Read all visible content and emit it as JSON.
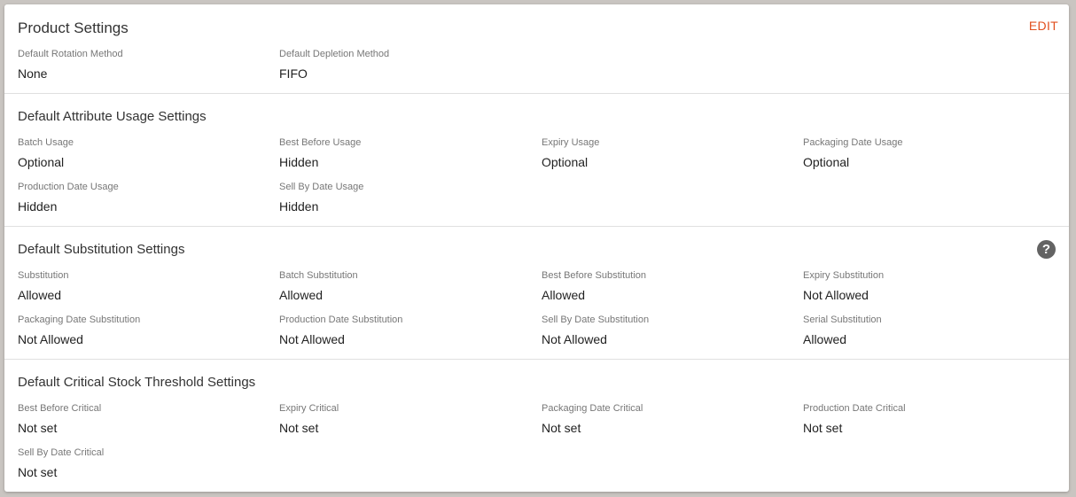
{
  "product_settings": {
    "title": "Product Settings",
    "edit_label": "EDIT",
    "fields": [
      {
        "label": "Default Rotation Method",
        "value": "None"
      },
      {
        "label": "Default Depletion Method",
        "value": "FIFO"
      }
    ]
  },
  "attribute_usage": {
    "title": "Default Attribute Usage Settings",
    "fields": [
      {
        "label": "Batch Usage",
        "value": "Optional"
      },
      {
        "label": "Best Before Usage",
        "value": "Hidden"
      },
      {
        "label": "Expiry Usage",
        "value": "Optional"
      },
      {
        "label": "Packaging Date Usage",
        "value": "Optional"
      },
      {
        "label": "Production Date Usage",
        "value": "Hidden"
      },
      {
        "label": "Sell By Date Usage",
        "value": "Hidden"
      }
    ]
  },
  "substitution": {
    "title": "Default Substitution Settings",
    "help_icon": "?",
    "fields": [
      {
        "label": "Substitution",
        "value": "Allowed"
      },
      {
        "label": "Batch Substitution",
        "value": "Allowed"
      },
      {
        "label": "Best Before Substitution",
        "value": "Allowed"
      },
      {
        "label": "Expiry Substitution",
        "value": "Not Allowed"
      },
      {
        "label": "Packaging Date Substitution",
        "value": "Not Allowed"
      },
      {
        "label": "Production Date Substitution",
        "value": "Not Allowed"
      },
      {
        "label": "Sell By Date Substitution",
        "value": "Not Allowed"
      },
      {
        "label": "Serial Substitution",
        "value": "Allowed"
      }
    ]
  },
  "critical_stock": {
    "title": "Default Critical Stock Threshold Settings",
    "fields": [
      {
        "label": "Best Before Critical",
        "value": "Not set"
      },
      {
        "label": "Expiry Critical",
        "value": "Not set"
      },
      {
        "label": "Packaging Date Critical",
        "value": "Not set"
      },
      {
        "label": "Production Date Critical",
        "value": "Not set"
      },
      {
        "label": "Sell By Date Critical",
        "value": "Not set"
      }
    ]
  },
  "colors": {
    "accent": "#e1501f",
    "help_icon_bg": "#636363"
  },
  "icons": {
    "help": "help-circle-icon"
  }
}
